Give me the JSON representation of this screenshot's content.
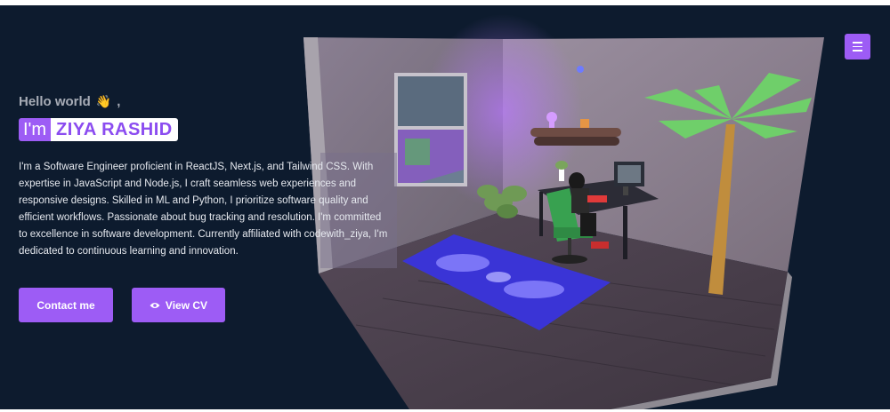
{
  "hero": {
    "greeting": "Hello world",
    "greeting_suffix": ",",
    "wave_icon": "👋",
    "im_label": "I'm",
    "name": "ZIYA RASHID",
    "bio": "I'm a Software Engineer proficient in ReactJS, Next.js, and Tailwind CSS. With expertise in JavaScript and Node.js, I craft seamless web experiences and responsive designs. Skilled in ML and Python, I prioritize software quality and efficient workflows. Passionate about bug tracking and resolution. I'm committed to excellence in software development. Currently affiliated with codewith_ziya, I'm dedicated to continuous learning and innovation."
  },
  "buttons": {
    "contact_label": "Contact me",
    "cv_label": "View CV",
    "cv_icon": "eye-icon"
  },
  "nav": {
    "menu_icon": "hamburger-menu-icon"
  },
  "colors": {
    "background": "#0d1b2e",
    "accent": "#9d5cf5",
    "name_text": "#8b4cf0"
  }
}
